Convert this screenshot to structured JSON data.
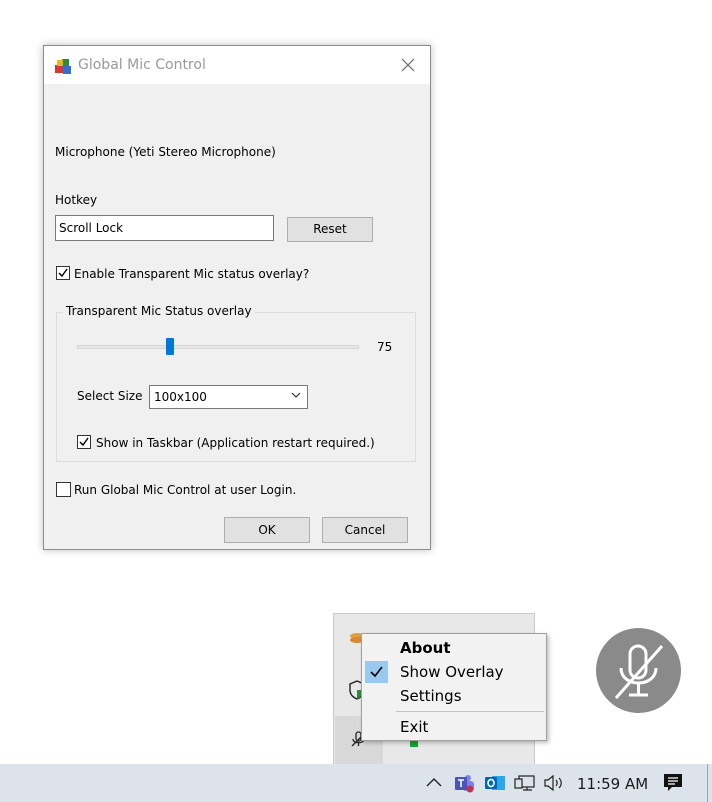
{
  "dialog": {
    "title": "Global Mic Control",
    "microphone_label": "Microphone (Yeti Stereo Microphone)",
    "hotkey_label": "Hotkey",
    "hotkey_value": "Scroll Lock",
    "reset_label": "Reset",
    "enable_overlay_label": "Enable Transparent Mic status overlay?",
    "enable_overlay_checked": true,
    "group_title": "Transparent Mic Status overlay",
    "slider_value": "75",
    "slider_fraction": 0.33,
    "select_size_label": "Select Size",
    "select_size_value": "100x100",
    "show_taskbar_label": "Show in Taskbar (Application restart required.)",
    "show_taskbar_checked": true,
    "run_login_label": "Run Global Mic Control at user Login.",
    "run_login_checked": false,
    "ok_label": "OK",
    "cancel_label": "Cancel"
  },
  "context_menu": {
    "items": [
      {
        "label": "About",
        "bold": true,
        "checked": false
      },
      {
        "label": "Show Overlay",
        "bold": false,
        "checked": true
      },
      {
        "label": "Settings",
        "bold": false,
        "checked": false
      },
      {
        "label": "Exit",
        "bold": false,
        "checked": false
      }
    ]
  },
  "taskbar": {
    "time": "11:59 AM",
    "icons": [
      "chevron-up-icon",
      "teams-icon",
      "outlook-icon",
      "network-icon",
      "volume-icon",
      "notification-icon"
    ]
  },
  "overlay": {
    "icon": "muted-microphone-icon",
    "color": "#8a8a8a"
  },
  "colors": {
    "accent": "#0078d7",
    "dialog_bg": "#f0f0f0",
    "taskbar_bg": "#dde3ea"
  }
}
